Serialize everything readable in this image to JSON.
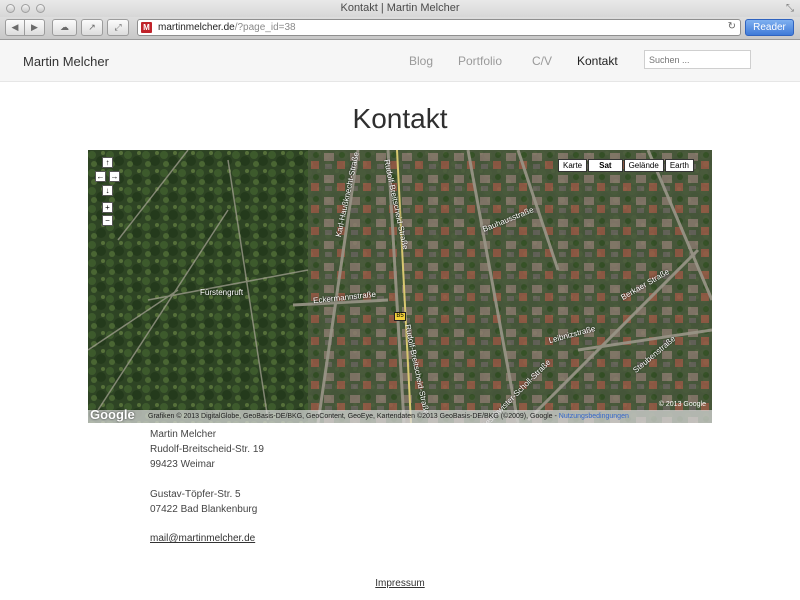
{
  "window": {
    "title": "Kontakt | Martin Melcher"
  },
  "browser": {
    "url_domain": "martinmelcher.de",
    "url_path": "/?page_id=38",
    "favicon_letter": "M",
    "reader_label": "Reader",
    "back_icon": "◀",
    "forward_icon": "▶",
    "cloud_icon": "☁",
    "share_icon": "↗",
    "fullscreen_icon": "⤢",
    "reload_icon": "↻",
    "resize_icon": "⤡"
  },
  "site": {
    "name": "Martin Melcher",
    "nav": [
      "Blog",
      "Portfolio",
      "C/V",
      "Kontakt"
    ],
    "active_nav": "Kontakt",
    "search_placeholder": "Suchen ..."
  },
  "page": {
    "title": "Kontakt"
  },
  "map": {
    "types": [
      "Karte",
      "Sat",
      "Gelände",
      "Earth"
    ],
    "selected_type": "Sat",
    "controls": {
      "up": "↑",
      "left": "←",
      "right": "→",
      "down": "↓",
      "zoom_in": "+",
      "zoom_out": "−"
    },
    "labels": {
      "kaiser": "Karl-Haußknecht-Straße",
      "rudolf1": "Rudolf-Breitscheid-Straße",
      "rudolf2": "Rudolf-Breitscheid-Straße",
      "bauhaus": "Bauhausstraße",
      "eckermann": "Eckermannstraße",
      "fuerstengruft": "Fürstengruft",
      "berkaer": "Berkaer Straße",
      "geschwister": "Geschwister-Scholl-Straße",
      "steubenstr": "Steubenstraße",
      "leibnizstr": "Leibnizstraße"
    },
    "road_badge": "B5",
    "copyright": "© 2013 Google",
    "attribution": "Grafiken © 2013 DigitalGlobe, GeoBasis-DE/BKG, GeoContent, GeoEye, Kartendaten ©2013 GeoBasis-DE/BKG (©2009), Google - ",
    "attribution_link": "Nutzungsbedingungen",
    "logo": "Google"
  },
  "contact": {
    "name": "Martin Melcher",
    "street1": "Rudolf-Breitscheid-Str. 19",
    "city1": "99423 Weimar",
    "street2": "Gustav-Töpfer-Str. 5",
    "city2": "07422 Bad Blankenburg",
    "email": "mail@martinmelcher.de"
  },
  "footer": {
    "impressum": "Impressum"
  }
}
